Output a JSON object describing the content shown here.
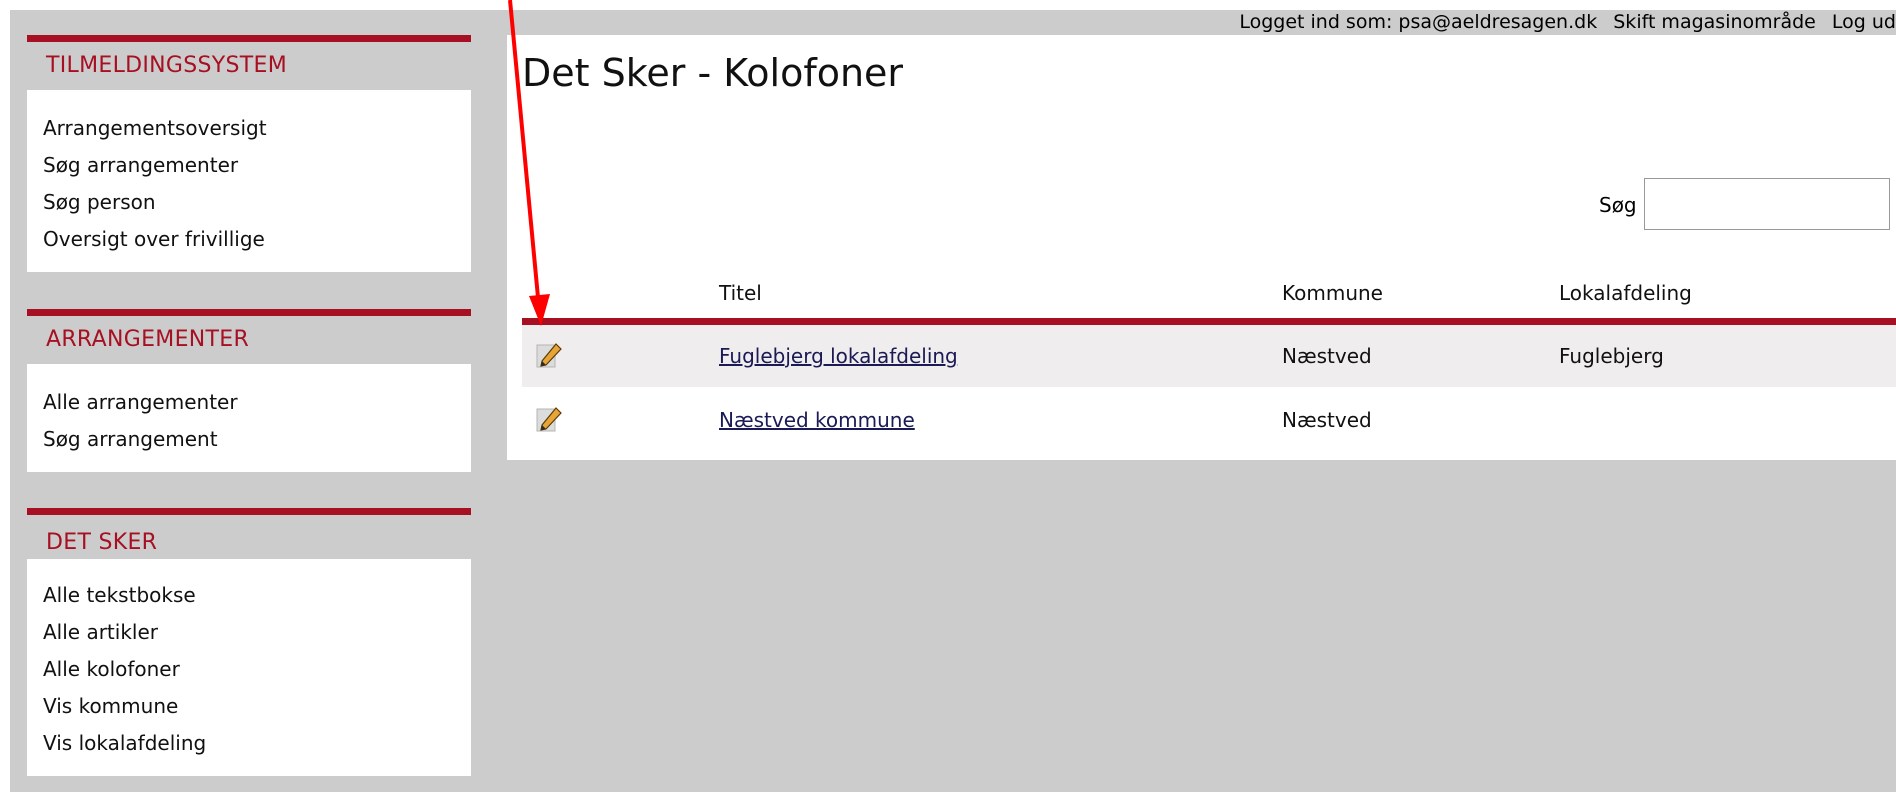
{
  "topbar": {
    "logged_in_label": "Logget ind som: psa@aeldresagen.dk",
    "switch_area": "Skift magasinområde",
    "logout": "Log ud"
  },
  "sidebar": {
    "sections": [
      {
        "heading": "TILMELDINGSSYSTEM",
        "items": [
          "Arrangementsoversigt",
          "Søg arrangementer",
          "Søg person",
          "Oversigt over frivillige"
        ]
      },
      {
        "heading": "ARRANGEMENTER",
        "items": [
          "Alle arrangementer",
          "Søg arrangement"
        ]
      },
      {
        "heading": "DET SKER",
        "items": [
          "Alle tekstbokse",
          "Alle artikler",
          "Alle kolofoner",
          "Vis kommune",
          "Vis lokalafdeling"
        ]
      }
    ]
  },
  "main": {
    "title": "Det Sker - Kolofoner",
    "search": {
      "label": "Søg",
      "value": "",
      "placeholder": ""
    },
    "table": {
      "headers": {
        "title": "Titel",
        "municipality": "Kommune",
        "local": "Lokalafdeling"
      },
      "rows": [
        {
          "title": "Fuglebjerg lokalafdeling",
          "municipality": "Næstved",
          "local": "Fuglebjerg"
        },
        {
          "title": "Næstved kommune",
          "municipality": "Næstved",
          "local": ""
        }
      ]
    }
  },
  "icons": {
    "edit": "pencil-icon"
  },
  "colors": {
    "accent": "#a70f22",
    "background": "#cccccc",
    "row_alt": "#efeded",
    "annotation_arrow": "#ff0000"
  }
}
